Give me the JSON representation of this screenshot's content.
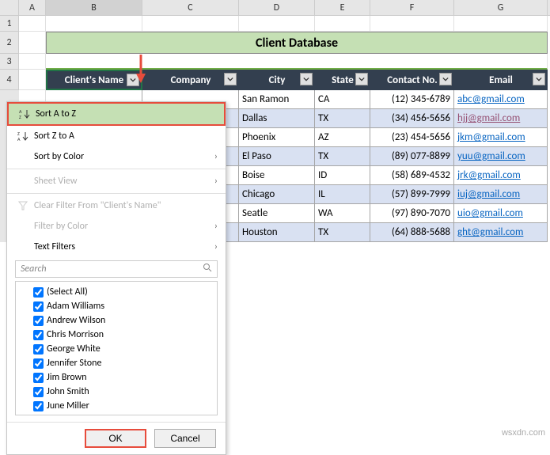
{
  "columns": [
    "A",
    "B",
    "C",
    "D",
    "E",
    "F",
    "G"
  ],
  "selected_column": "B",
  "rows_visible": [
    "1",
    "2",
    "3",
    "4"
  ],
  "title": "Client Database",
  "headers": {
    "name": "Client's Name",
    "company": "Company",
    "city": "City",
    "state": "State",
    "contact": "Contact No.",
    "email": "Email"
  },
  "data": [
    {
      "city": "San Ramon",
      "state": "CA",
      "contact": "(12) 345-6789",
      "email": "abc@gmail.com",
      "visited": false
    },
    {
      "city": "Dallas",
      "state": "TX",
      "contact": "(34) 456-5656",
      "email": "hjj@gmail.com",
      "visited": true
    },
    {
      "city": "Phoenix",
      "state": "AZ",
      "contact": "(23) 454-5656",
      "email": "jkm@gmail.com",
      "visited": false
    },
    {
      "city": "El Paso",
      "state": "TX",
      "contact": "(89) 077-8899",
      "email": "yuu@gmail.com",
      "visited": false
    },
    {
      "city": "Boise",
      "state": "ID",
      "contact": "(58) 689-4532",
      "email": "jrk@gmail.com",
      "visited": false
    },
    {
      "city": "Chicago",
      "state": "IL",
      "contact": "(57) 899-7999",
      "email": "iuj@gmail.com",
      "visited": false
    },
    {
      "city": "Seatle",
      "state": "WA",
      "contact": "(97) 890-7070",
      "email": "uio@gmail.com",
      "visited": false
    },
    {
      "city": "Houston",
      "state": "TX",
      "contact": "(64) 888-5688",
      "email": "ght@gmail.com",
      "visited": false
    }
  ],
  "menu": {
    "sort_az": "Sort A to Z",
    "sort_za": "Sort Z to A",
    "sort_color": "Sort by Color",
    "sheet_view": "Sheet View",
    "clear_filter": "Clear Filter From \"Client's Name\"",
    "filter_color": "Filter by Color",
    "text_filters": "Text Filters",
    "search_placeholder": "Search",
    "items": [
      "(Select All)",
      "Adam Williams",
      "Andrew Wilson",
      "Chris Morrison",
      "George White",
      "Jennifer Stone",
      "Jim Brown",
      "John Smith",
      "June Miller"
    ],
    "ok": "OK",
    "cancel": "Cancel"
  },
  "watermark": "wsxdn.com"
}
